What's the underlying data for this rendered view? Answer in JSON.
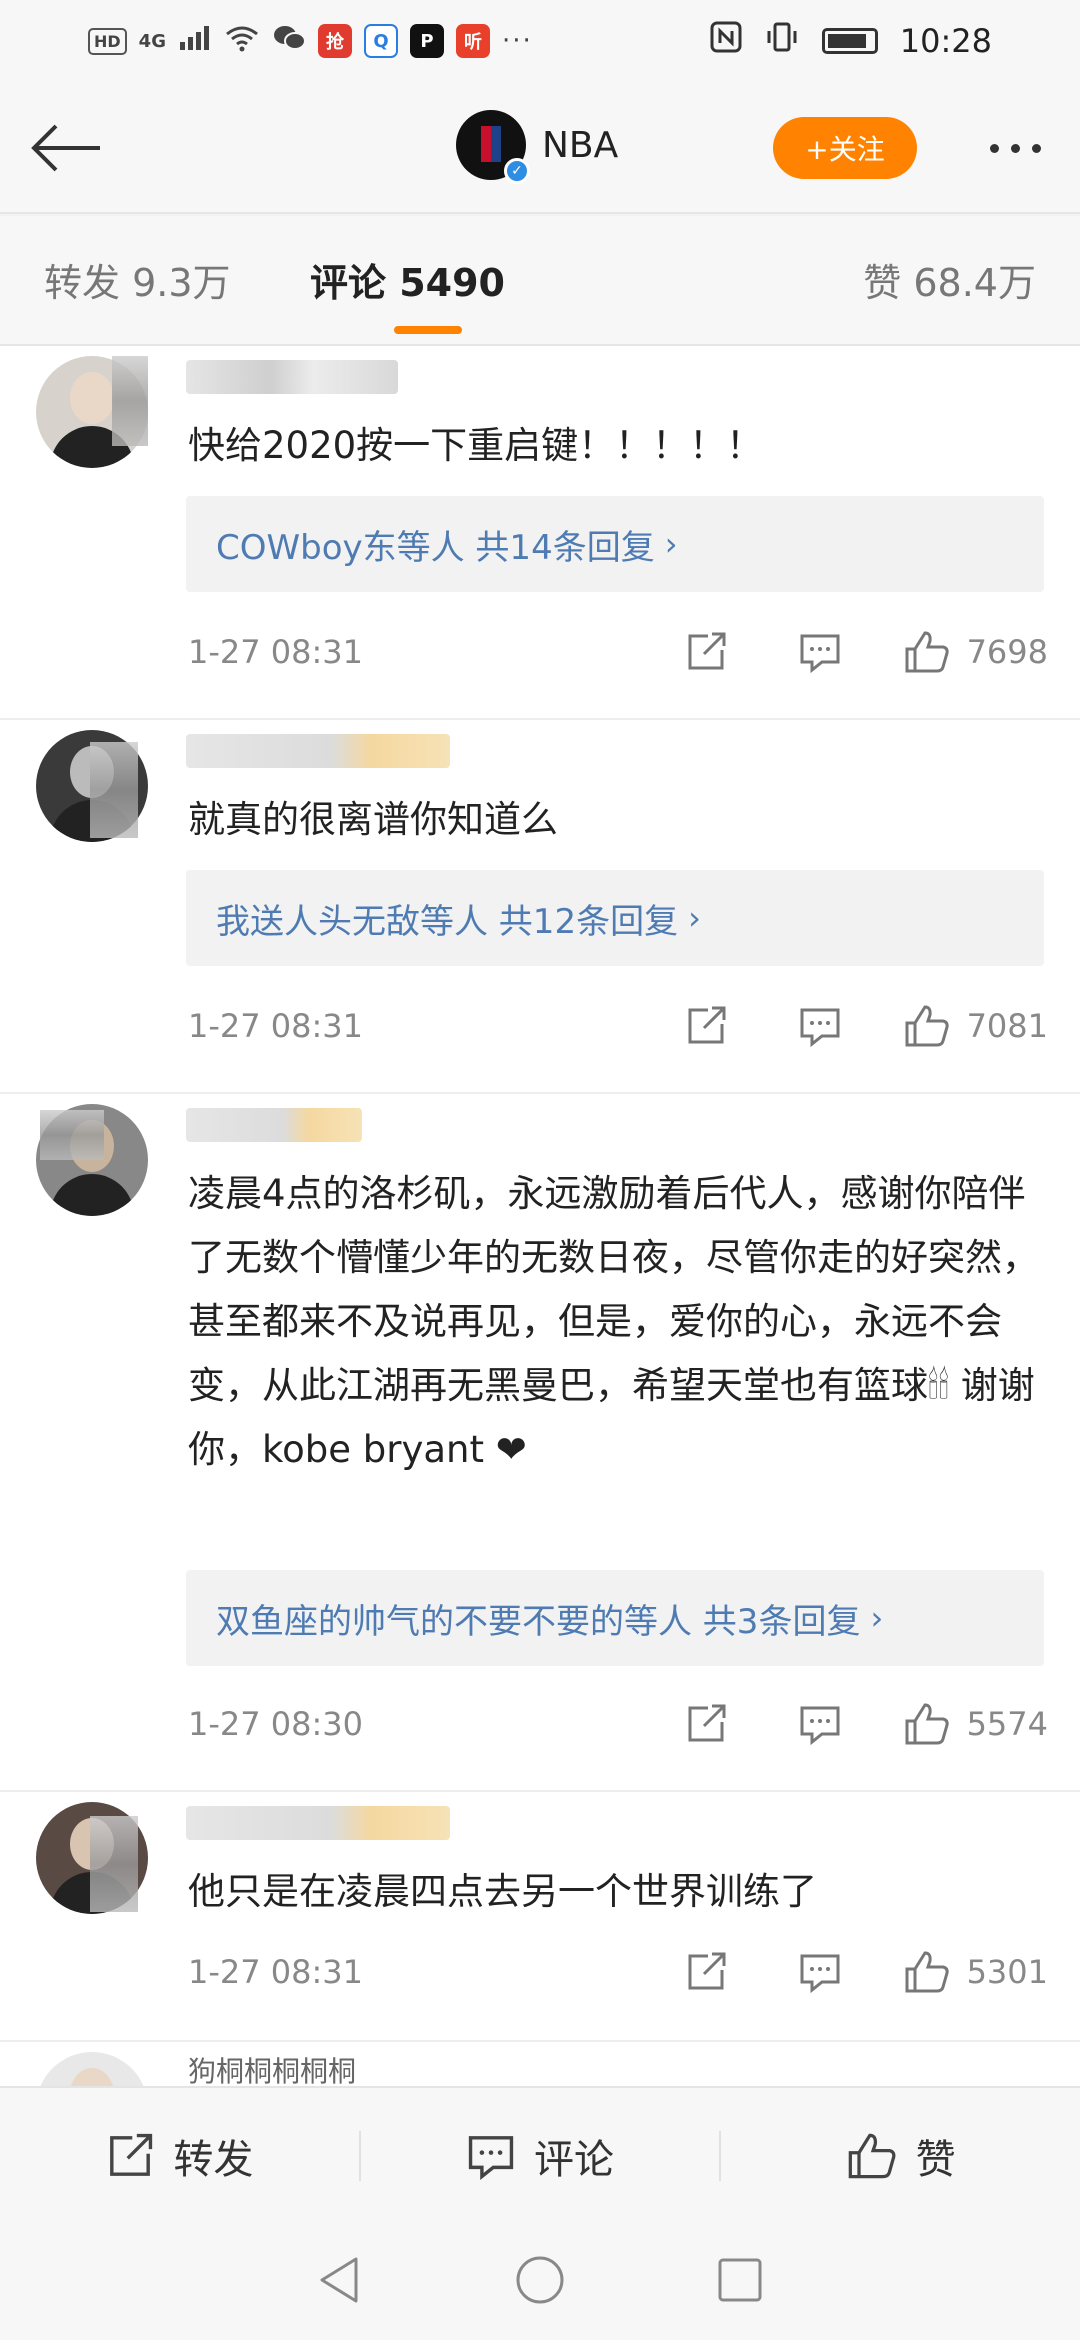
{
  "status_bar": {
    "left_indicators": [
      "HD",
      "4G"
    ],
    "time": "10:28"
  },
  "header": {
    "title": "NBA",
    "follow_label": "+关注",
    "accent_color": "#ff8200"
  },
  "tabs": {
    "repost": "转发 9.3万",
    "comment": "评论 5490",
    "like": "赞 68.4万"
  },
  "comments": [
    {
      "text": "快给2020按一下重启键！！！！！",
      "reply": "COWboy东等人  共14条回复",
      "time": "1-27 08:31",
      "likes": "7698"
    },
    {
      "text": "就真的很离谱你知道么",
      "reply": "我送人头无敌等人  共12条回复",
      "time": "1-27 08:31",
      "likes": "7081"
    },
    {
      "text": "凌晨4点的洛杉矶，永远激励着后代人，感谢你陪伴了无数个懵懂少年的无数日夜，尽管你走的好突然，甚至都来不及说再见，但是，爱你的心，永远不会变，从此江湖再无黑曼巴，希望天堂也有篮球🕯🕯 谢谢你，kobe bryant ❤",
      "reply": "双鱼座的帅气的不要不要的等人  共3条回复",
      "time": "1-27 08:30",
      "likes": "5574"
    },
    {
      "text": "他只是在凌晨四点去另一个世界训练了",
      "time": "1-27 08:31",
      "likes": "5301"
    },
    {
      "name": "狗桐桐桐桐桐"
    }
  ],
  "bottom_bar": {
    "repost": "转发",
    "comment": "评论",
    "like": "赞"
  },
  "link_color": "#4f7bb3"
}
